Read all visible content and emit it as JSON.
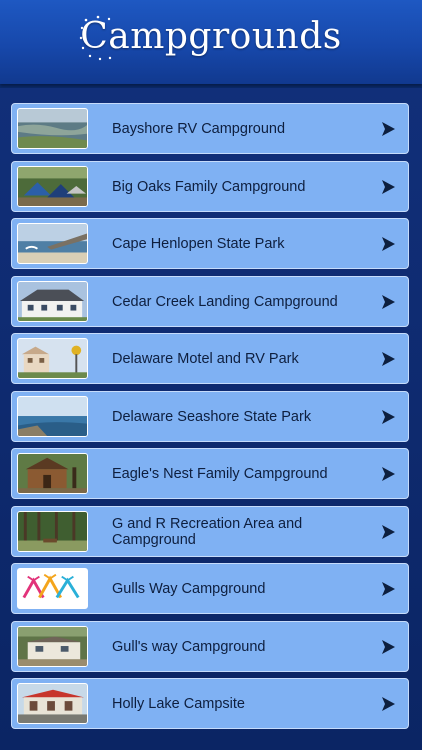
{
  "header": {
    "title": "Campgrounds"
  },
  "items": [
    {
      "label": "Bayshore RV Campground",
      "thumb": "aerial-bay-photo"
    },
    {
      "label": "Big Oaks Family Campground",
      "thumb": "tents-photo"
    },
    {
      "label": "Cape Henlopen State Park",
      "thumb": "beach-pier-photo"
    },
    {
      "label": "Cedar Creek Landing Campground",
      "thumb": "white-house-photo"
    },
    {
      "label": "Delaware Motel and RV Park",
      "thumb": "motel-photo"
    },
    {
      "label": "Delaware Seashore State Park",
      "thumb": "seashore-photo"
    },
    {
      "label": "Eagle's Nest Family Campground",
      "thumb": "cabin-photo"
    },
    {
      "label": "G and R Recreation Area and Campground",
      "thumb": "forest-photo"
    },
    {
      "label": "Gulls Way Campground",
      "thumb": "tents-logo"
    },
    {
      "label": "Gull's way Campground",
      "thumb": "mobile-home-photo"
    },
    {
      "label": "Holly Lake Campsite",
      "thumb": "red-roof-building-photo"
    }
  ]
}
